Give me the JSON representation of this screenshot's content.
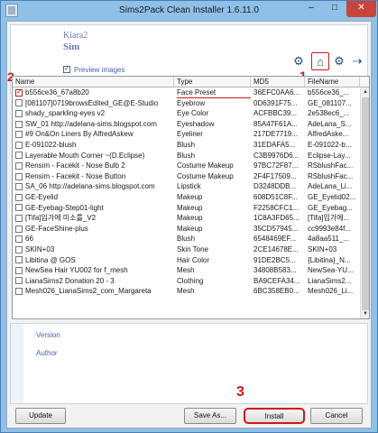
{
  "window": {
    "title": "Sims2Pack Clean Installer 1.6.11.0",
    "minimize": "–",
    "maximize": "□",
    "close": "✕"
  },
  "header": {
    "creator": "Kiara2",
    "title": "Sim",
    "preview_label": "Preview images",
    "preview_checked": "✓"
  },
  "toolbar": {
    "icons": [
      "gear-icon",
      "home-icon",
      "plugin-icon",
      "arrow-icon"
    ]
  },
  "annotations": {
    "mark1": "1",
    "mark2": "2",
    "mark3": "3"
  },
  "table": {
    "columns": [
      "Name",
      "Type",
      "MD5",
      "FileName"
    ],
    "rows": [
      {
        "checked": "✓",
        "name": "b556ce36_67a8b20",
        "type": "Face Preset",
        "md5": "36EFC0AA6...",
        "file": "b556ce36_..."
      },
      {
        "checked": "",
        "name": "[081107]0719browsEdited_GE@E-Studio",
        "type": "Eyebrow",
        "md5": "0D6391F75...",
        "file": "GE_081107..."
      },
      {
        "checked": "",
        "name": "shady_sparkling-eyes v2",
        "type": "Eye Color",
        "md5": "ACFBBC39...",
        "file": "2e538ec6_..."
      },
      {
        "checked": "",
        "name": "SW_01 http://adelana-sims.blogspot.com",
        "type": "Eyeshadow",
        "md5": "85A47F61A...",
        "file": "AdeLana_S..."
      },
      {
        "checked": "",
        "name": "#9 On&On Liners By AlfredAskew",
        "type": "Eyeliner",
        "md5": "217DE7719...",
        "file": "AlfredAske..."
      },
      {
        "checked": "",
        "name": "E-091022-blush",
        "type": "Blush",
        "md5": "31EDAFA5...",
        "file": "E-091022-b..."
      },
      {
        "checked": "",
        "name": "Layerable Mouth Corner ~(D.Eclipse)",
        "type": "Blush",
        "md5": "C3B9976D6...",
        "file": "Eclipse-Lay..."
      },
      {
        "checked": "",
        "name": "Rensim - Facekit - Nose Bulb 2",
        "type": "Costume Makeup",
        "md5": "97BC72F87...",
        "file": "RSblushFac..."
      },
      {
        "checked": "",
        "name": "Rensim - Facekit - Nose Button",
        "type": "Costume Makeup",
        "md5": "2F4F1750​9...",
        "file": "RSblushFac..."
      },
      {
        "checked": "",
        "name": "SA_06 http://adelana-sims.blogspot.com",
        "type": "Lipstick",
        "md5": "D3248DDB...",
        "file": "AdeLana_Li..."
      },
      {
        "checked": "",
        "name": "GE-Eyelid",
        "type": "Makeup",
        "md5": "608D51C8F...",
        "file": "GE_Eyelid02..."
      },
      {
        "checked": "",
        "name": "GE-Eyebag-Step01-light",
        "type": "Makeup",
        "md5": "F2258CFC1...",
        "file": "GE_Eyebag..."
      },
      {
        "checked": "",
        "name": "[Tifa]입가에 미소를_V2",
        "type": "Makeup",
        "md5": "1C8A3FD65...",
        "file": "[Tifa]입가에..."
      },
      {
        "checked": "",
        "name": "GE-FaceShine-plus",
        "type": "Makeup",
        "md5": "35CD57945...",
        "file": "cc9993e84f..."
      },
      {
        "checked": "",
        "name": "66",
        "type": "Blush",
        "md5": "6548469EF...",
        "file": "4a8aa511_..."
      },
      {
        "checked": "",
        "name": "SKIN+03",
        "type": "Skin Tone",
        "md5": "2CE14678E...",
        "file": "SKIN+03"
      },
      {
        "checked": "",
        "name": "Libitina @ GOS",
        "type": "Hair Color",
        "md5": "91DE2BC5...",
        "file": "{Libitina}_N..."
      },
      {
        "checked": "",
        "name": "NewSea Hair YU002 for f_mesh",
        "type": "Mesh",
        "md5": "34808B583...",
        "file": "NewSea-YU..."
      },
      {
        "checked": "",
        "name": "LianaSims2 Donation 20 - 3",
        "type": "Clothing",
        "md5": "BA9CEFA34...",
        "file": "LianaSims2..."
      },
      {
        "checked": "",
        "name": "Mesh026_LianaSims2_com_Margareta",
        "type": "Mesh",
        "md5": "6BC358EB0...",
        "file": "Mesh026_Li..."
      }
    ]
  },
  "info": {
    "version_label": "Version",
    "author_label": "Author"
  },
  "buttons": {
    "update": "Update",
    "save_as": "Save As...",
    "install": "Install",
    "cancel": "Cancel"
  }
}
